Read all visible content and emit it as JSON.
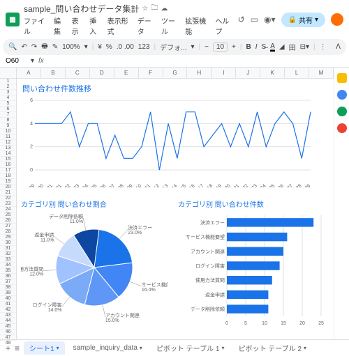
{
  "header": {
    "doc_title": "sample_問い合わせデータ集計",
    "menus": [
      "ファイル",
      "編集",
      "表示",
      "挿入",
      "表示形式",
      "データ",
      "ツール",
      "拡張機能",
      "ヘルプ"
    ],
    "share_label": "共有"
  },
  "toolbar": {
    "zoom": "100%",
    "currency": "¥",
    "percent": "%",
    "decimals": ".0 .00",
    "numfmt": "123",
    "font": "デフォ...",
    "fontsize": "10"
  },
  "namebox": {
    "cell": "O60",
    "fx": "fx"
  },
  "columns": [
    "A",
    "B",
    "C",
    "D",
    "E",
    "F",
    "G",
    "H",
    "I",
    "J",
    "K",
    "L",
    "M"
  ],
  "row_count": 48,
  "chart_data": [
    {
      "type": "line",
      "title": "問い合わせ件数推移",
      "ylim": [
        0,
        6
      ],
      "yticks": [
        0,
        2,
        4,
        6
      ],
      "categories": [
        "2024/10/29",
        "2024/10/30",
        "2024/10/31",
        "2024/11/01",
        "2024/11/02",
        "2024/11/03",
        "2024/11/04",
        "2024/11/05",
        "2024/11/06",
        "2024/11/07",
        "2024/11/08",
        "2024/11/09",
        "2024/11/10",
        "2024/11/11",
        "2024/11/12",
        "2024/11/13",
        "2024/11/14",
        "2024/11/15",
        "2024/11/16",
        "2024/11/17",
        "2024/11/18",
        "2024/11/19",
        "2024/11/20",
        "2024/11/21",
        "2024/11/22",
        "2024/11/23",
        "2024/11/24",
        "2024/11/25",
        "2024/11/26",
        "2024/11/27",
        "2024/11/28",
        "2024/11/29"
      ],
      "values": [
        4,
        4,
        4,
        4,
        5,
        2,
        4,
        4,
        1,
        3,
        1,
        1,
        2,
        5,
        0,
        4,
        1,
        5,
        5,
        2,
        3,
        4,
        2,
        4,
        2,
        5,
        2,
        4,
        5,
        4,
        1,
        5
      ]
    },
    {
      "type": "pie",
      "title": "カテゴリ別 問い合わせ割合",
      "slices": [
        {
          "label": "決済エラー",
          "pct": 23.0
        },
        {
          "label": "サービス機能要望",
          "pct": 16.0
        },
        {
          "label": "アカウント関連",
          "pct": 15.0
        },
        {
          "label": "ログイン障害",
          "pct": 14.0
        },
        {
          "label": "使用方法質問",
          "pct": 12.0
        },
        {
          "label": "返金申請",
          "pct": 11.0
        },
        {
          "label": "データ削除依頼",
          "pct": 11.0
        }
      ]
    },
    {
      "type": "bar",
      "title": "カテゴリ別 問い合わせ件数",
      "xlim": [
        0,
        25
      ],
      "xticks": [
        0,
        5,
        10,
        15,
        20,
        25
      ],
      "categories": [
        "決済エラー",
        "サービス機能要望",
        "アカウント関連",
        "ログイン障害",
        "使用方法質問",
        "返金申請",
        "データ削除依頼"
      ],
      "values": [
        23,
        16,
        15,
        14,
        12,
        11,
        11
      ]
    }
  ],
  "tabs": {
    "items": [
      "シート1",
      "sample_inquiry_data",
      "ピボット テーブル 1",
      "ピボット テーブル 2"
    ],
    "active": 0
  }
}
